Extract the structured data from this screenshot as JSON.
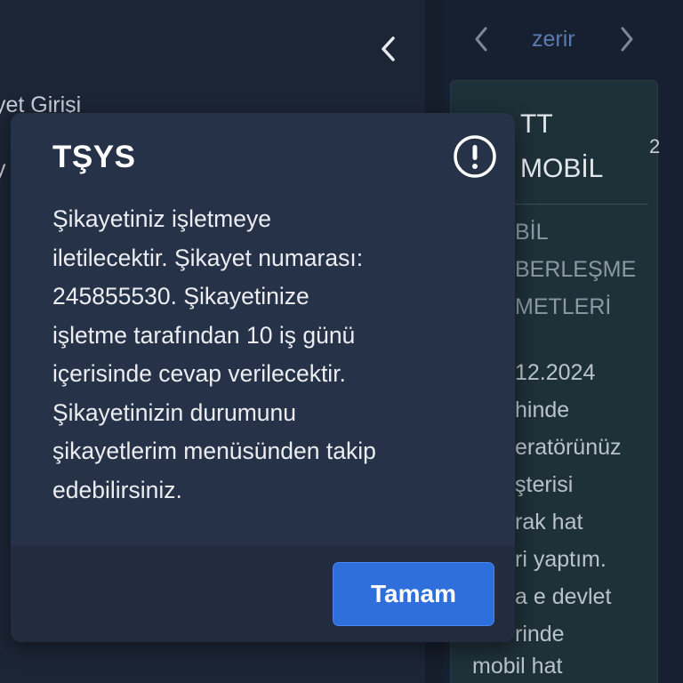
{
  "background": {
    "left_rows": [
      "yet Girişi",
      "y"
    ],
    "nav_label": "zerir",
    "card": {
      "title_lines": [
        "TT",
        "MOBİL"
      ],
      "subtitle_lines": [
        "BİL",
        "BERLEŞME",
        "METLERİ"
      ],
      "body_lines": [
        "12.2024",
        "hinde",
        "eratörünüz",
        "şterisi",
        "rak hat",
        "ri yaptım.",
        "a e devlet",
        "rinde",
        "mobil hat"
      ]
    },
    "side_digit": "2"
  },
  "modal": {
    "title": "TŞYS",
    "message_lines": [
      "Şikayetiniz işletmeye",
      "iletilecektir. Şikayet numarası:",
      "245855530. Şikayetinize",
      "işletme tarafından 10 iş günü",
      "içerisinde cevap verilecektir.",
      "Şikayetinizin durumunu",
      "şikayetlerim menüsünden takip",
      "edebilirsiniz."
    ],
    "ok_label": "Tamam"
  },
  "icons": {
    "back": "chevron-left-icon",
    "prev": "chevron-left-icon",
    "next": "chevron-right-icon",
    "info": "exclamation-circle-icon"
  },
  "colors": {
    "accent": "#2f6fdc",
    "modal_bg": "#263247",
    "card_bg": "#1e3038"
  }
}
